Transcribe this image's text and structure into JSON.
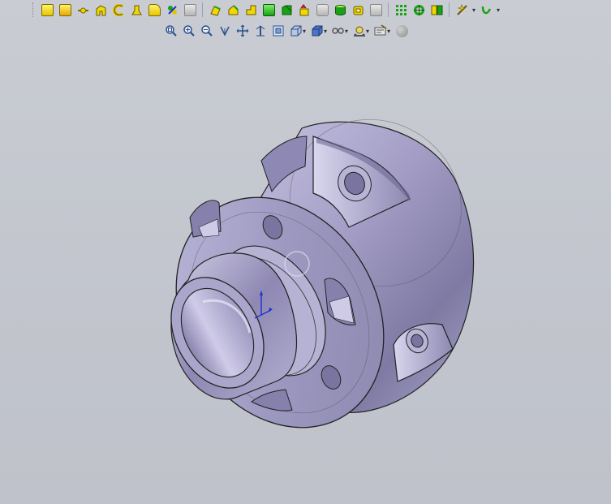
{
  "toolbar_main": {
    "tools": [
      {
        "icon": "sketch-icon"
      },
      {
        "icon": "smart-dimension-icon"
      },
      {
        "icon": "line-icon"
      },
      {
        "icon": "extruded-boss-icon"
      },
      {
        "icon": "revolve-icon"
      },
      {
        "icon": "swept-boss-icon"
      },
      {
        "icon": "lofted-boss-icon"
      },
      {
        "icon": "boundary-boss-icon"
      },
      {
        "icon": "extruded-cut-icon"
      },
      {
        "icon": "revolved-cut-icon"
      },
      {
        "icon": "swept-cut-icon"
      },
      {
        "icon": "lofted-cut-icon"
      },
      {
        "icon": "fillet-icon"
      },
      {
        "icon": "chamfer-icon"
      },
      {
        "icon": "rib-icon"
      },
      {
        "icon": "shell-icon"
      },
      {
        "icon": "draft-icon"
      },
      {
        "icon": "dome-icon"
      },
      {
        "icon": "linear-pattern-icon"
      },
      {
        "icon": "circular-pattern-icon"
      },
      {
        "icon": "mirror-icon"
      },
      {
        "icon": "reference-geometry-icon"
      },
      {
        "icon": "curves-icon"
      }
    ]
  },
  "toolbar_view": {
    "tools": [
      {
        "icon": "zoom-to-fit-icon"
      },
      {
        "icon": "zoom-to-area-icon"
      },
      {
        "icon": "zoom-in-out-icon"
      },
      {
        "icon": "rotate-view-icon"
      },
      {
        "icon": "pan-icon"
      },
      {
        "icon": "section-view-icon"
      },
      {
        "icon": "view-orientation-icon"
      },
      {
        "icon": "display-style-icon"
      },
      {
        "icon": "hide-show-items-icon"
      },
      {
        "icon": "edit-appearance-icon"
      },
      {
        "icon": "apply-scene-icon"
      },
      {
        "icon": "view-settings-icon"
      },
      {
        "icon": "realview-icon"
      }
    ]
  },
  "viewport": {
    "background_color": "#c5c8cf",
    "part_color": "#a6a1c4",
    "triad_color": "#1a33cc"
  }
}
